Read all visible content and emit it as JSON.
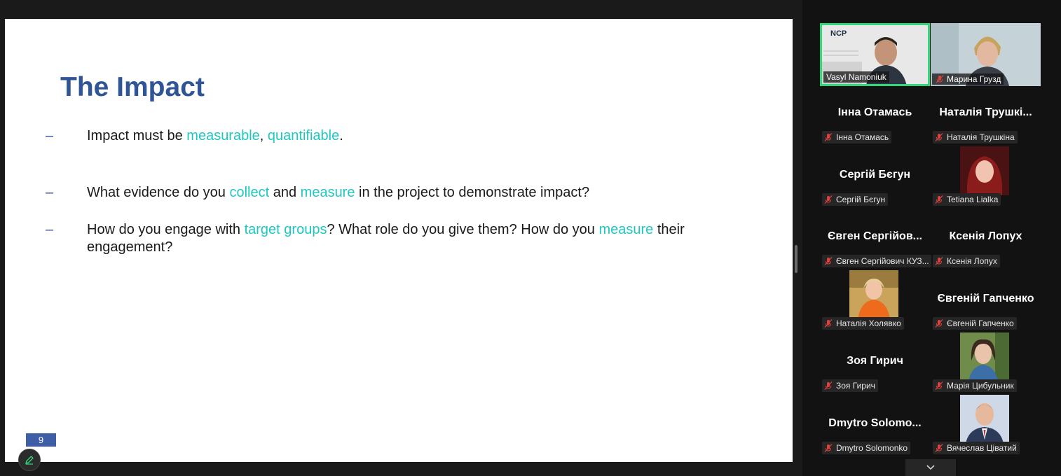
{
  "slide": {
    "title": "The Impact",
    "page_number": "9",
    "bullets": [
      {
        "dash": "–",
        "parts": [
          {
            "t": "Impact must be ",
            "h": false
          },
          {
            "t": "measurable",
            "h": true
          },
          {
            "t": ", ",
            "h": false
          },
          {
            "t": "quantifiable",
            "h": true
          },
          {
            "t": ".",
            "h": false
          }
        ]
      },
      {
        "dash": "–",
        "parts": [
          {
            "t": "What evidence do you ",
            "h": false
          },
          {
            "t": "collect",
            "h": true
          },
          {
            "t": " and ",
            "h": false
          },
          {
            "t": "measure",
            "h": true
          },
          {
            "t": " in the project to demonstrate impact?",
            "h": false
          }
        ]
      },
      {
        "dash": "–",
        "parts": [
          {
            "t": "How do you engage with ",
            "h": false
          },
          {
            "t": "target groups",
            "h": true
          },
          {
            "t": "? What role do you give them? How do you ",
            "h": false
          },
          {
            "t": "measure",
            "h": true
          },
          {
            "t": " their engagement?",
            "h": false
          }
        ]
      }
    ]
  },
  "panel": {
    "video_tiles": [
      {
        "name": "Vasyl Namoniuk",
        "muted": false,
        "speaking": true,
        "logo_text": "NCP"
      },
      {
        "name": "Марина Грузд",
        "muted": true,
        "speaking": false
      }
    ],
    "participants": [
      {
        "display": "Інна Отамась",
        "label": "Інна Отамась",
        "has_photo": false
      },
      {
        "display": "Наталія Трушкі...",
        "label": "Наталія Трушкіна",
        "has_photo": false
      },
      {
        "display": "Сергій Бєгун",
        "label": "Сергій Бєгун",
        "has_photo": false
      },
      {
        "display": "",
        "label": "Tetiana Lialka",
        "has_photo": true,
        "photo": "red-hair"
      },
      {
        "display": "Євген Сергійов...",
        "label": "Євген Сергійович КУЗ...",
        "has_photo": false
      },
      {
        "display": "Ксенія Лопух",
        "label": "Ксенія Лопух",
        "has_photo": false
      },
      {
        "display": "",
        "label": "Наталія Холявко",
        "has_photo": true,
        "photo": "orange"
      },
      {
        "display": "Євгеній Гапченко",
        "label": "Євгеній Гапченко",
        "has_photo": false
      },
      {
        "display": "Зоя Гирич",
        "label": "Зоя Гирич",
        "has_photo": false
      },
      {
        "display": "",
        "label": "Марія Цибульник",
        "has_photo": true,
        "photo": "green"
      },
      {
        "display": "Dmytro Solomo...",
        "label": "Dmytro Solomonko",
        "has_photo": false
      },
      {
        "display": "",
        "label": "Вячеслав Ціватий",
        "has_photo": true,
        "photo": "suit"
      }
    ]
  },
  "colors": {
    "title": "#2f5597",
    "highlight": "#1ec8c0",
    "speaking_border": "#2fd67a",
    "mic_muted": "#e0413c"
  },
  "icons": {
    "annotate": "pencil-icon",
    "mic": "mic-muted-icon",
    "scroll": "chevron-down-icon"
  }
}
